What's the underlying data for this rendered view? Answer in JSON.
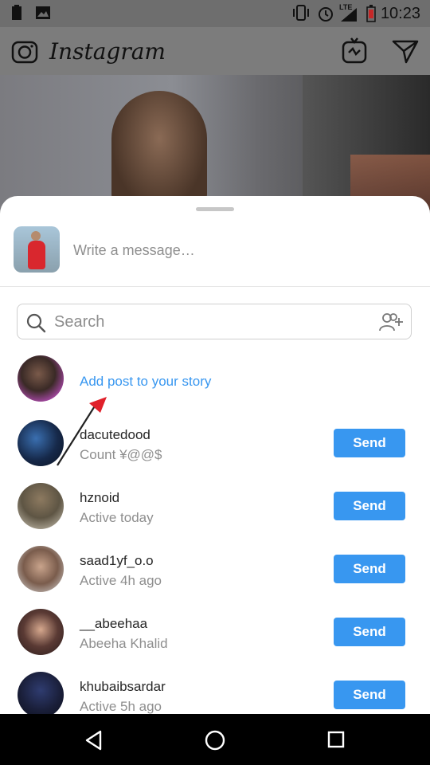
{
  "status_bar": {
    "time": "10:23",
    "network": "LTE"
  },
  "app_bar": {
    "title": "Instagram"
  },
  "share_sheet": {
    "message_placeholder": "Write a message…",
    "search_placeholder": "Search",
    "story_label": "Add post to your story",
    "recipients": [
      {
        "username": "dacutedood",
        "subtitle": "Count  ¥@@$",
        "send_label": "Send"
      },
      {
        "username": "hznoid",
        "subtitle": "Active today",
        "send_label": "Send"
      },
      {
        "username": "saad1yf_o.o",
        "subtitle": "Active 4h ago",
        "send_label": "Send"
      },
      {
        "username": "__abeehaa",
        "subtitle": "Abeeha Khalid",
        "send_label": "Send"
      },
      {
        "username": "khubaibsardar",
        "subtitle": "Active 5h ago",
        "send_label": "Send"
      }
    ]
  },
  "colors": {
    "accent": "#3897f0",
    "annotation_arrow": "#e0202a"
  }
}
